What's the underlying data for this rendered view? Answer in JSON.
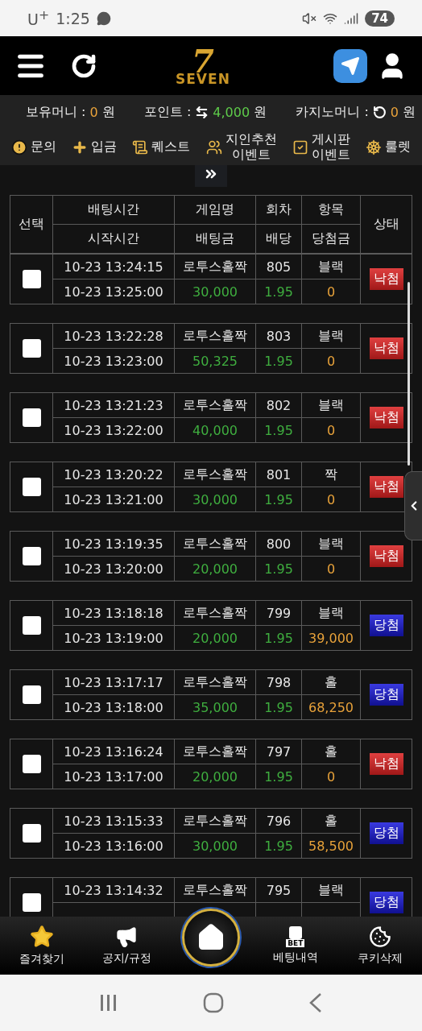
{
  "status_bar": {
    "carrier": "U$^{+}$",
    "time": "1:25",
    "battery": "74"
  },
  "header": {
    "logo": {
      "numeral": "7",
      "word": "SEVEN"
    }
  },
  "balances": [
    {
      "label": "보유머니 :",
      "value": "0",
      "unit": "원",
      "kind": "plain"
    },
    {
      "label": "포인트 :",
      "value": "4,000",
      "unit": "원",
      "kind": "exchange"
    },
    {
      "label": "카지노머니 :",
      "value": "0",
      "unit": "원",
      "kind": "reload"
    }
  ],
  "menu": [
    {
      "label": "문의"
    },
    {
      "label": "입금"
    },
    {
      "label": "퀘스트"
    },
    {
      "label": "지인추천\n이벤트"
    },
    {
      "label": "게시판\n이벤트"
    },
    {
      "label": "룰렛"
    }
  ],
  "table": {
    "columns": [
      {
        "top": "선택"
      },
      {
        "top": "배팅시간",
        "bottom": "시작시간"
      },
      {
        "top": "게임명",
        "bottom": "배팅금"
      },
      {
        "top": "회차",
        "bottom": "배당"
      },
      {
        "top": "항목",
        "bottom": "당첨금"
      },
      {
        "top": "상태"
      }
    ],
    "rows": [
      {
        "checked": false,
        "bet_time": "10-23 13:24:15",
        "game": "로투스홀짝",
        "round": "805",
        "pick": "블랙",
        "start_time": "10-23 13:25:00",
        "amount": "30,000",
        "odds": "1.95",
        "payout": "0",
        "status": {
          "label": "낙첨",
          "kind": "lost"
        }
      },
      {
        "checked": false,
        "bet_time": "10-23 13:22:28",
        "game": "로투스홀짝",
        "round": "803",
        "pick": "블랙",
        "start_time": "10-23 13:23:00",
        "amount": "50,325",
        "odds": "1.95",
        "payout": "0",
        "status": {
          "label": "낙첨",
          "kind": "lost"
        }
      },
      {
        "checked": false,
        "bet_time": "10-23 13:21:23",
        "game": "로투스홀짝",
        "round": "802",
        "pick": "블랙",
        "start_time": "10-23 13:22:00",
        "amount": "40,000",
        "odds": "1.95",
        "payout": "0",
        "status": {
          "label": "낙첨",
          "kind": "lost"
        }
      },
      {
        "checked": false,
        "bet_time": "10-23 13:20:22",
        "game": "로투스홀짝",
        "round": "801",
        "pick": "짝",
        "start_time": "10-23 13:21:00",
        "amount": "30,000",
        "odds": "1.95",
        "payout": "0",
        "status": {
          "label": "낙첨",
          "kind": "lost"
        }
      },
      {
        "checked": false,
        "bet_time": "10-23 13:19:35",
        "game": "로투스홀짝",
        "round": "800",
        "pick": "블랙",
        "start_time": "10-23 13:20:00",
        "amount": "20,000",
        "odds": "1.95",
        "payout": "0",
        "status": {
          "label": "낙첨",
          "kind": "lost"
        }
      },
      {
        "checked": false,
        "bet_time": "10-23 13:18:18",
        "game": "로투스홀짝",
        "round": "799",
        "pick": "블랙",
        "start_time": "10-23 13:19:00",
        "amount": "20,000",
        "odds": "1.95",
        "payout": "39,000",
        "status": {
          "label": "당첨",
          "kind": "won"
        }
      },
      {
        "checked": false,
        "bet_time": "10-23 13:17:17",
        "game": "로투스홀짝",
        "round": "798",
        "pick": "홀",
        "start_time": "10-23 13:18:00",
        "amount": "35,000",
        "odds": "1.95",
        "payout": "68,250",
        "status": {
          "label": "당첨",
          "kind": "won"
        }
      },
      {
        "checked": false,
        "bet_time": "10-23 13:16:24",
        "game": "로투스홀짝",
        "round": "797",
        "pick": "홀",
        "start_time": "10-23 13:17:00",
        "amount": "20,000",
        "odds": "1.95",
        "payout": "0",
        "status": {
          "label": "낙첨",
          "kind": "lost"
        }
      },
      {
        "checked": false,
        "bet_time": "10-23 13:15:33",
        "game": "로투스홀짝",
        "round": "796",
        "pick": "홀",
        "start_time": "10-23 13:16:00",
        "amount": "30,000",
        "odds": "1.95",
        "payout": "58,500",
        "status": {
          "label": "당첨",
          "kind": "won"
        }
      },
      {
        "checked": false,
        "bet_time": "10-23 13:14:32",
        "game": "로투스홀짝",
        "round": "795",
        "pick": "블랙",
        "status": {
          "label": "당첨",
          "kind": "won"
        }
      }
    ]
  },
  "bottom_nav": [
    {
      "label": "즐겨찾기",
      "kind": "star"
    },
    {
      "label": "공지/규정",
      "kind": "notice"
    },
    {
      "kind": "home"
    },
    {
      "label": "베팅내역",
      "kind": "bet",
      "badge": "BET"
    },
    {
      "label": "쿠키삭제",
      "kind": "cookie"
    }
  ]
}
